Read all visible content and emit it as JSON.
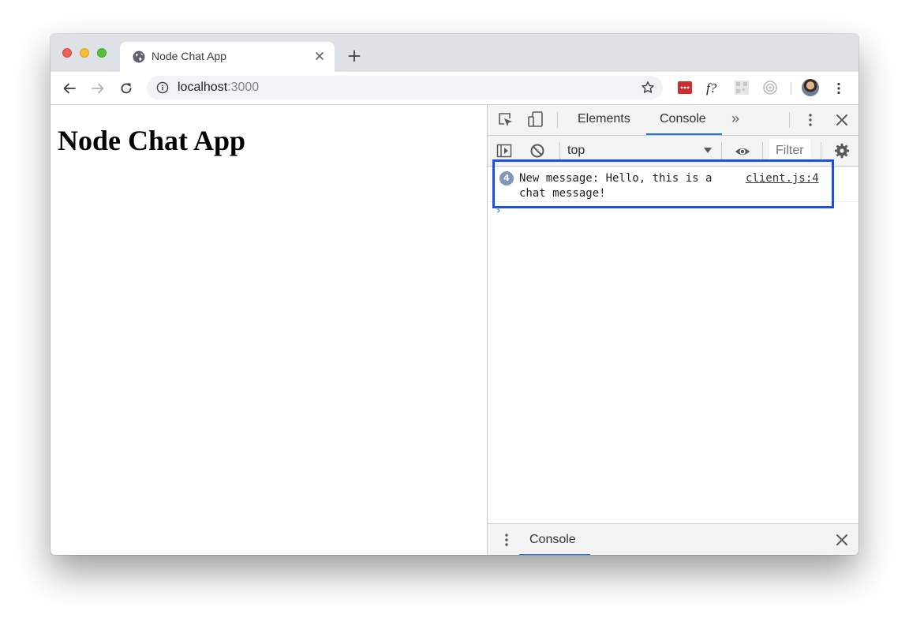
{
  "browser": {
    "tab": {
      "title": "Node Chat App"
    },
    "url": {
      "host": "localhost",
      "port": ":3000"
    },
    "extensions": [
      "lastpass-icon",
      "fontface-icon",
      "qr-icon",
      "target-icon"
    ]
  },
  "page": {
    "heading": "Node Chat App"
  },
  "devtools": {
    "tabs": [
      "Elements",
      "Console"
    ],
    "active_tab": "Console",
    "context": "top",
    "filter_placeholder": "Filter",
    "console_messages": [
      {
        "count": "4",
        "text": "New message: Hello, this is a chat message!",
        "source": "client.js:4"
      }
    ],
    "prompt": "›",
    "drawer": {
      "tab": "Console"
    }
  },
  "colors": {
    "highlight_border": "#1f4fe0",
    "accent": "#1a73e8",
    "count_badge": "#8097bd"
  }
}
